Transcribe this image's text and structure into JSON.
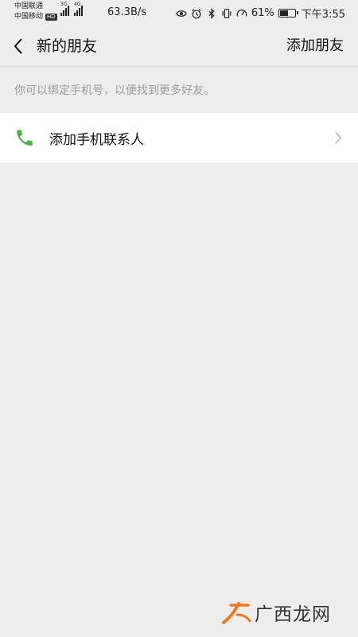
{
  "status_bar": {
    "carrier_1": "中国联通",
    "carrier_2": "中国移动",
    "hd_label": "HD",
    "net_1": "3G",
    "net_2": "4G",
    "speed": "63.3B/s",
    "battery_text": "61%",
    "battery_level": 0.61,
    "time": "下午3:55"
  },
  "nav": {
    "title": "新的朋友",
    "action_label": "添加朋友"
  },
  "hint": {
    "text": "你可以绑定手机号，以便找到更多好友。"
  },
  "contacts_row": {
    "label": "添加手机联系人"
  },
  "watermark": {
    "text": "广西龙网"
  },
  "colors": {
    "background": "#ededed",
    "accent_green": "#4cb050",
    "hint_gray": "#9b9b9b",
    "watermark_orange": "#f07a22"
  }
}
